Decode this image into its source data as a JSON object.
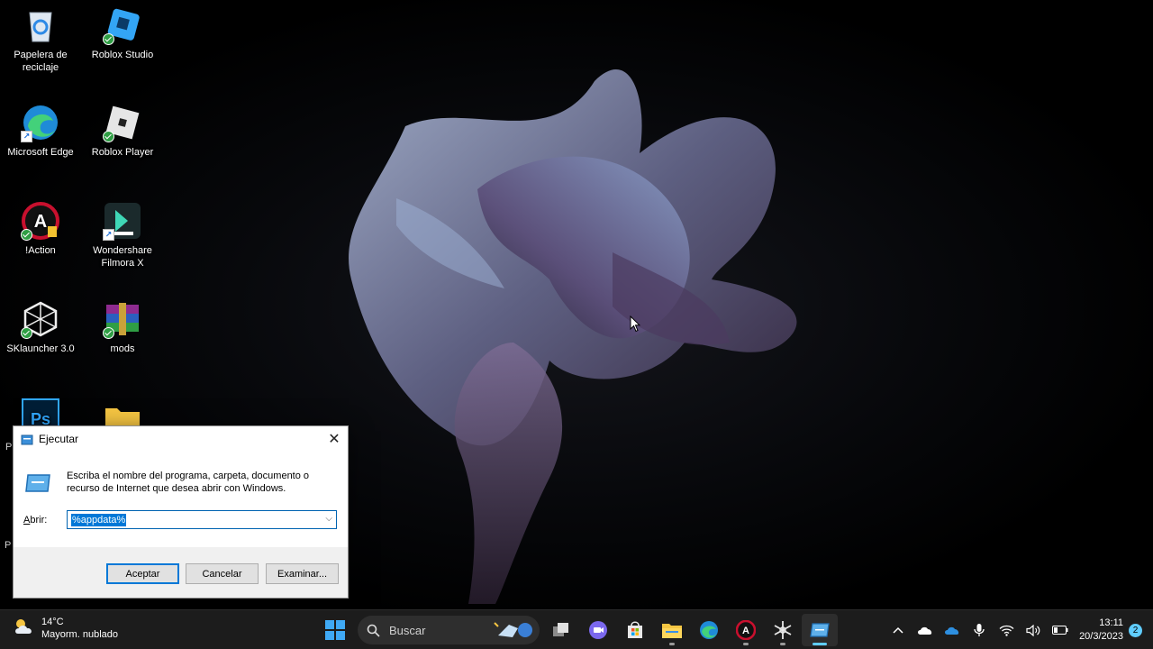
{
  "desktop": {
    "icons": [
      {
        "label": "Papelera de reciclaje",
        "icon": "recycle-bin-icon"
      },
      {
        "label": "Roblox Studio",
        "icon": "roblox-studio-icon"
      },
      {
        "label": "Microsoft Edge",
        "icon": "edge-icon"
      },
      {
        "label": "Roblox Player",
        "icon": "roblox-player-icon"
      },
      {
        "label": "!Action",
        "icon": "action-icon"
      },
      {
        "label": "Wondershare Filmora X",
        "icon": "filmora-icon"
      },
      {
        "label": "SKlauncher 3.0",
        "icon": "sklauncher-icon"
      },
      {
        "label": "mods",
        "icon": "winrar-icon"
      },
      {
        "label": "P",
        "icon": "photoshop-icon"
      },
      {
        "label": "",
        "icon": "folder-icon"
      },
      {
        "label": "P",
        "icon": "partial-icon"
      }
    ]
  },
  "run_dialog": {
    "title": "Ejecutar",
    "description": "Escriba el nombre del programa, carpeta, documento o recurso de Internet que desea abrir con Windows.",
    "open_label_prefix": "A",
    "open_label_rest": "brir:",
    "input_value": "%appdata%",
    "ok_label": "Aceptar",
    "cancel_label": "Cancelar",
    "browse_label": "Examinar..."
  },
  "taskbar": {
    "weather_temp": "14°C",
    "weather_desc": "Mayorm. nublado",
    "search_placeholder": "Buscar",
    "time": "13:11",
    "date": "20/3/2023",
    "notification_count": "2",
    "apps": [
      "start-icon",
      "search-icon",
      "task-view-icon",
      "teams-chat-icon",
      "store-icon",
      "file-explorer-icon",
      "edge-icon",
      "action-icon",
      "snowflake-app-icon",
      "run-icon"
    ]
  },
  "colors": {
    "accent": "#0078d7",
    "taskbar_bg": "#1c1c1c",
    "active_indicator": "#60cdff"
  }
}
